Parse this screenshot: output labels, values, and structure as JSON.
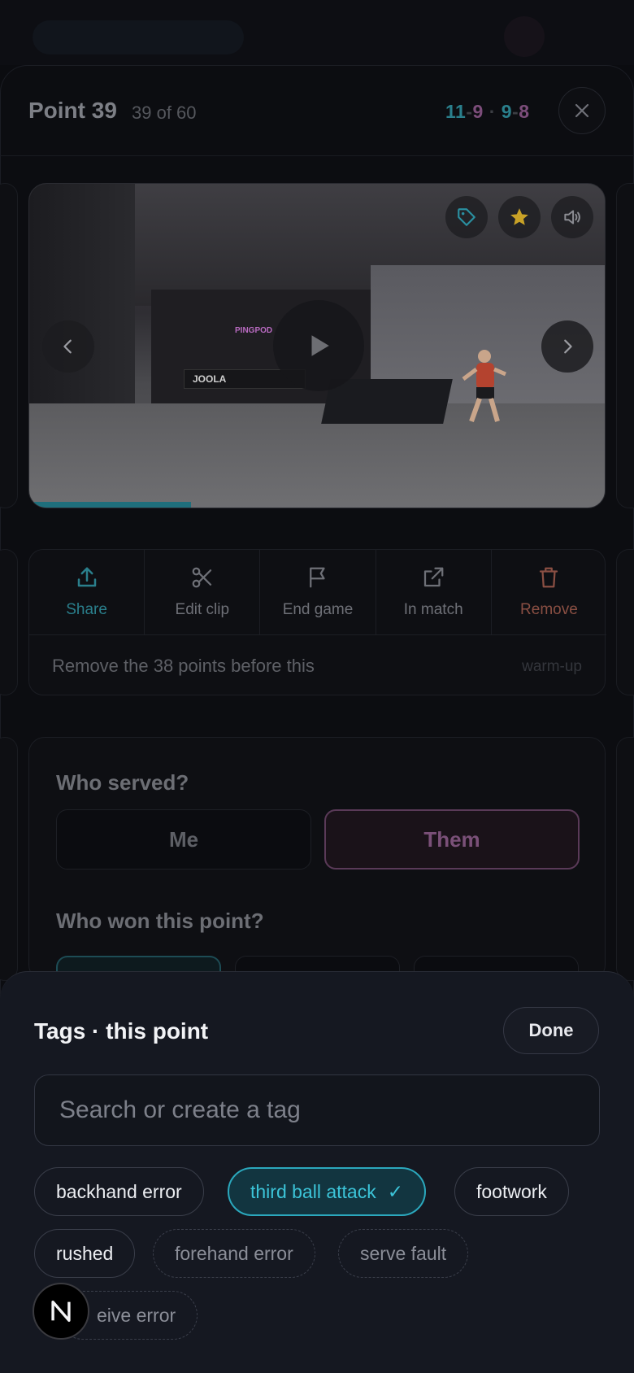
{
  "header": {
    "title": "Point 39",
    "subtitle": "39 of 60",
    "score": {
      "g1_me": "11",
      "g1_them": "9",
      "sep": "·",
      "g2_me": "9",
      "g2_them": "8",
      "dash": "-"
    }
  },
  "video": {
    "sign_text": "PINGPOD",
    "banner_text": "JOOLA",
    "progress": 0.28,
    "controls": [
      "tag-icon",
      "star-icon",
      "volume-icon"
    ]
  },
  "actions": {
    "items": [
      {
        "label": "Share",
        "icon": "share-icon"
      },
      {
        "label": "Edit clip",
        "icon": "scissors-icon"
      },
      {
        "label": "End game",
        "icon": "flag-icon"
      },
      {
        "label": "In match",
        "icon": "external-link-icon"
      },
      {
        "label": "Remove",
        "icon": "trash-icon"
      }
    ],
    "warmup_text": "Remove the 38 points before this",
    "warmup_tag": "warm-up"
  },
  "form": {
    "served_question": "Who served?",
    "served_options": [
      "Me",
      "Them"
    ],
    "served_selected": "Them",
    "won_question": "Who won this point?"
  },
  "tags": {
    "title": "Tags · this point",
    "done_label": "Done",
    "search_placeholder": "Search or create a tag",
    "chips": [
      {
        "label": "backhand error",
        "state": "applied"
      },
      {
        "label": "third ball attack",
        "state": "selected",
        "check": "✓"
      },
      {
        "label": "footwork",
        "state": "applied"
      },
      {
        "label": "rushed",
        "state": "applied"
      },
      {
        "label": "forehand error",
        "state": "suggested"
      },
      {
        "label": "serve fault",
        "state": "suggested"
      },
      {
        "label": "eive error",
        "state": "suggested"
      }
    ]
  },
  "badge": {
    "letter": "N"
  },
  "colors": {
    "teal": "#2ba8bd",
    "purple": "#7c4d7a",
    "remove_red": "#8a4f43",
    "star_gold": "#c9a227"
  }
}
